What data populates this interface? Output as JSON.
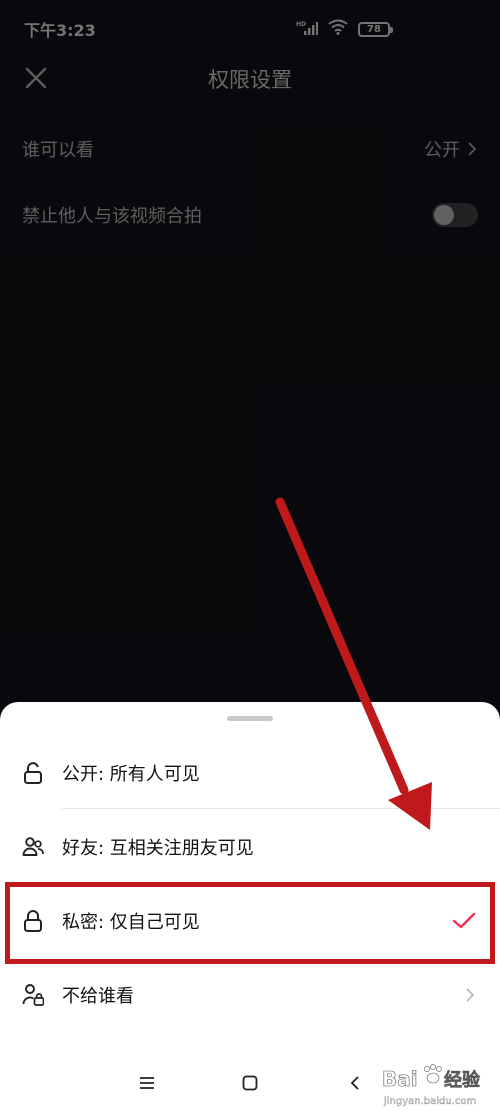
{
  "status_bar": {
    "time": "下午3:23",
    "network": "HD",
    "battery": "78"
  },
  "header": {
    "title": "权限设置"
  },
  "settings": {
    "who_can_see": {
      "label": "谁可以看",
      "value": "公开"
    },
    "duet": {
      "label": "禁止他人与该视频合拍",
      "enabled": false
    }
  },
  "sheet": {
    "options": [
      {
        "icon": "unlock-icon",
        "label": "公开: 所有人可见",
        "selected": false
      },
      {
        "icon": "friends-icon",
        "label": "好友: 互相关注朋友可见",
        "selected": false
      },
      {
        "icon": "lock-icon",
        "label": "私密: 仅自己可见",
        "selected": true
      },
      {
        "icon": "user-lock-icon",
        "label": "不给谁看",
        "selected": false
      }
    ]
  },
  "colors": {
    "accent": "#fe2c55",
    "annotation": "#c0191c",
    "background": "#16161d"
  },
  "watermark": {
    "brand": "Bai",
    "brand2": "经验",
    "url": "jingyan.baidu.com"
  }
}
